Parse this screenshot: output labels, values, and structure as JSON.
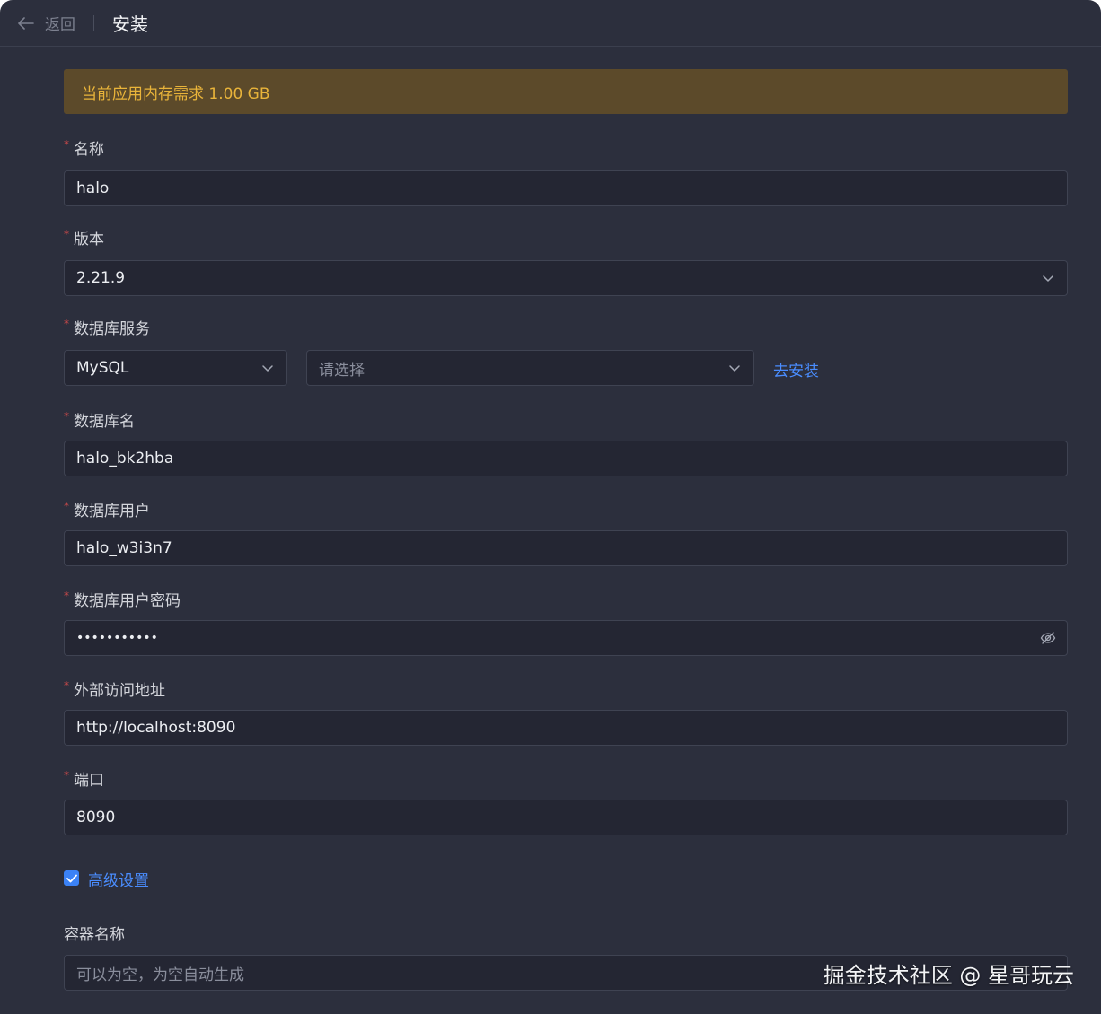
{
  "header": {
    "back_label": "返回",
    "title": "安装"
  },
  "alert": {
    "text": "当前应用内存需求 1.00 GB"
  },
  "form": {
    "name": {
      "label": "名称",
      "value": "halo"
    },
    "version": {
      "label": "版本",
      "value": "2.21.9"
    },
    "db_service": {
      "label": "数据库服务",
      "type_value": "MySQL",
      "instance_placeholder": "请选择",
      "install_link": "去安装"
    },
    "db_name": {
      "label": "数据库名",
      "value": "halo_bk2hba"
    },
    "db_user": {
      "label": "数据库用户",
      "value": "halo_w3i3n7"
    },
    "db_password": {
      "label": "数据库用户密码",
      "value": "•••••••••••"
    },
    "external_url": {
      "label": "外部访问地址",
      "value": "http://localhost:8090"
    },
    "port": {
      "label": "端口",
      "value": "8090"
    },
    "advanced": {
      "label": "高级设置",
      "checked": true
    },
    "container_name": {
      "label": "容器名称",
      "placeholder": "可以为空，为空自动生成"
    }
  },
  "watermark": "掘金技术社区 @ 星哥玩云",
  "colors": {
    "accent": "#3b82f6",
    "warning_bg": "#5c4a2a",
    "warning_text": "#e9b43a",
    "required": "#d24a4a"
  }
}
